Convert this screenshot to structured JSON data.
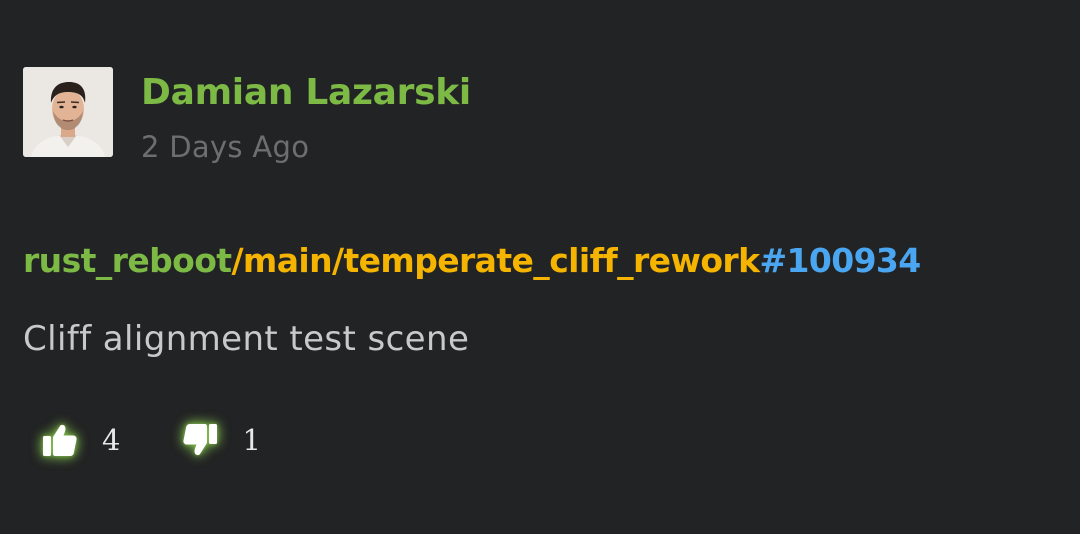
{
  "post": {
    "author": "Damian Lazarski",
    "time": "2 Days Ago",
    "avatar_icon": "user-avatar-photo"
  },
  "commit": {
    "repo": "rust_reboot",
    "branch": "/main/temperate_cliff_rework",
    "change": "#100934",
    "colors": {
      "repo": "#7cba45",
      "branch": "#f5b400",
      "change": "#4aa6f0",
      "author": "#7cba45"
    }
  },
  "message": "Cliff alignment test scene",
  "reactions": {
    "likes_icon": "thumbs-up-icon",
    "likes": "4",
    "dislikes_icon": "thumbs-down-icon",
    "dislikes": "1"
  }
}
